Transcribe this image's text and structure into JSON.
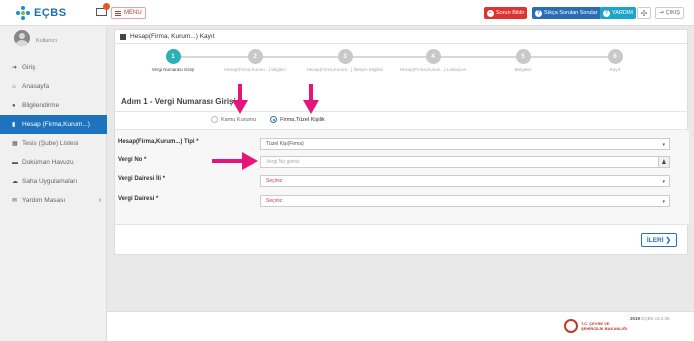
{
  "header": {
    "app_name": "EÇBS",
    "menu_label": "MENU",
    "report_error": "Sorun Bildir",
    "faq": "Sıkça Sorulan Sorular",
    "help": "YARDIM",
    "exit": "ÇIKIŞ"
  },
  "sidebar": {
    "user_name": "Kullanıcı",
    "items": [
      {
        "label": "Giriş",
        "icon": "sign-in-icon"
      },
      {
        "label": "Anasayfa",
        "icon": "home-icon"
      },
      {
        "label": "Bilgilendirme",
        "icon": "info-icon"
      },
      {
        "label": "Hesap (Firma,Kurum...)",
        "icon": "book-icon",
        "active": true
      },
      {
        "label": "Tesis (Şube) Listesi",
        "icon": "building-icon"
      },
      {
        "label": "Doküman Havuzu",
        "icon": "folder-icon"
      },
      {
        "label": "Saha Uygulamaları",
        "icon": "cloud-icon"
      },
      {
        "label": "Yardım Masası",
        "icon": "envelope-icon"
      }
    ]
  },
  "panel": {
    "title": "Hesap(Firma, Kurum...) Kayıt",
    "steps": [
      {
        "num": "1",
        "label": "Vergi Numarası Girişi",
        "active": true
      },
      {
        "num": "2",
        "label": "Hesap(Firma,Kurum...) Bilgileri"
      },
      {
        "num": "3",
        "label": "Hesap(Firma,Kurum...) İletişim Bilgileri"
      },
      {
        "num": "4",
        "label": "Hesap(Firma,Kurum...) Lokasyon"
      },
      {
        "num": "5",
        "label": "Belgeler"
      },
      {
        "num": "6",
        "label": "Kayıt"
      }
    ],
    "step_title": "Adım 1 - Vergi Numarası Girişi",
    "radio_options": [
      {
        "label": "Kamu Kurumu",
        "checked": false
      },
      {
        "label": "Firma,Tüzel Kişilik",
        "checked": true
      }
    ],
    "form": {
      "type_label": "Hesap(Firma,Kurum...) Tipi *",
      "type_value": "Tüzel Kişi(Firma)",
      "tax_no_label": "Vergi No *",
      "tax_no_placeholder": "Vergi No giriniz",
      "tax_office_city_label": "Vergi Dairesi İli *",
      "tax_office_city_value": "Seçiniz",
      "tax_office_label": "Vergi Dairesi *",
      "tax_office_value": "Seçiniz"
    },
    "next_button": "İLERİ"
  },
  "footer": {
    "ministry_line1": "T.C. ÇEVRE VE",
    "ministry_line2": "ŞEHİRCİLİK BAKANLIĞI",
    "year": "2019",
    "version": "EÇBS v3.0.35"
  },
  "colors": {
    "accent": "#1e73be",
    "step_active": "#2ab0b5",
    "annotation_arrow": "#e6157c"
  }
}
